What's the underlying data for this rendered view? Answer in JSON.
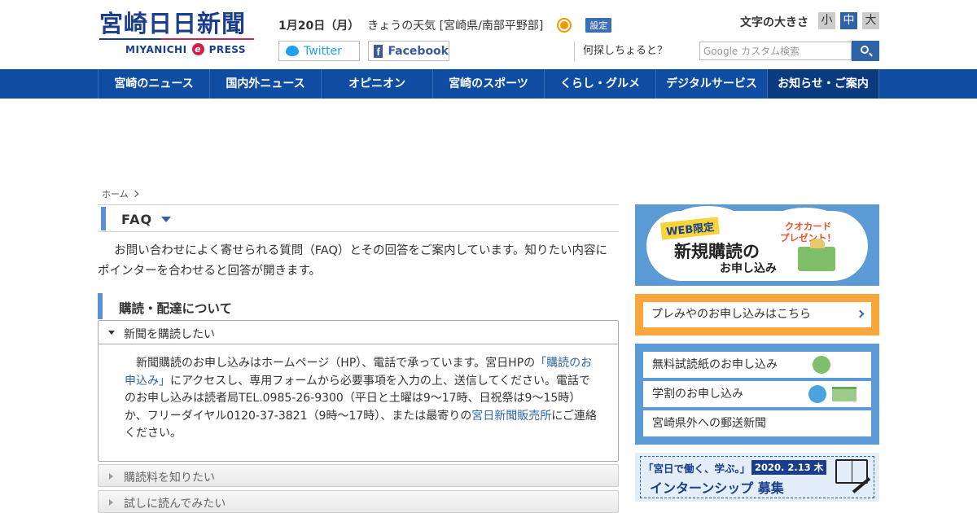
{
  "header": {
    "logo_main": "宮崎日日新聞",
    "logo_sub_left": "MIYANICHI",
    "logo_sub_e": "e",
    "logo_sub_right": "PRESS",
    "date": "1月20日（月）",
    "weather_label": "きょうの天気 [宮崎県/南部平野部]",
    "weather_icon": "sun-icon",
    "settings_label": "設定",
    "twitter_label": "Twitter",
    "facebook_label": "Facebook",
    "fontsize_label": "文字の大きさ",
    "fontsize_small": "小",
    "fontsize_mid": "中",
    "fontsize_large": "大",
    "search_question": "何探しちょると？",
    "search_placeholder": "Google カスタム検索"
  },
  "nav": {
    "items": [
      {
        "label": "宮崎のニュース"
      },
      {
        "label": "国内外ニュース"
      },
      {
        "label": "オピニオン"
      },
      {
        "label": "宮崎のスポーツ"
      },
      {
        "label": "くらし・グルメ"
      },
      {
        "label": "デジタルサービス"
      },
      {
        "label": "お知らせ・ご案内"
      }
    ]
  },
  "breadcrumb": {
    "home": "ホーム"
  },
  "faq": {
    "title": "FAQ",
    "intro": "お問い合わせによく寄せられる質問（FAQ）とその回答をご案内しています。知りたい内容にポインターを合わせると回答が開きます。",
    "section_title": "購読・配達について",
    "open_question": "新聞を購読したい",
    "answer_part1": "新聞購読のお申し込みはホームページ（HP）、電話で承っています。宮日HPの",
    "answer_link1": "「購読のお申込み」",
    "answer_part2": "にアクセスし、専用フォームから必要事項を入力の上、送信してください。電話でのお申し込みは読者局TEL.0985-26-9300（平日と土曜は9〜17時、日祝祭は9〜15時）か、フリーダイヤル0120-37-3821（9時〜17時）、または最寄りの",
    "answer_link2": "宮日新聞販売所",
    "answer_part3": "にご連絡ください。",
    "closed_questions": [
      {
        "label": "購読料を知りたい"
      },
      {
        "label": "試しに読んでみたい"
      }
    ]
  },
  "sidebar": {
    "sub_banner": {
      "badge": "WEB限定",
      "main": "新規購読の",
      "sub": "お申し込み",
      "quo_line1": "クオカード",
      "quo_line2": "プレゼント！"
    },
    "premium_link": "プレみやのお申し込みはこちら",
    "links": [
      {
        "label": "無料試読紙のお申し込み"
      },
      {
        "label": "学割のお申し込み"
      },
      {
        "label": "宮崎県外への郵送新聞"
      }
    ],
    "intern_banner": {
      "top": "「宮日で働く、学ぶ。」",
      "date": "2020. 2.13 木",
      "main": "インターンシップ 募集"
    }
  },
  "colors": {
    "brand_blue": "#0f4da3",
    "accent_blue": "#5b8fd8",
    "orange": "#f7a73c",
    "red": "#d21e4a"
  }
}
